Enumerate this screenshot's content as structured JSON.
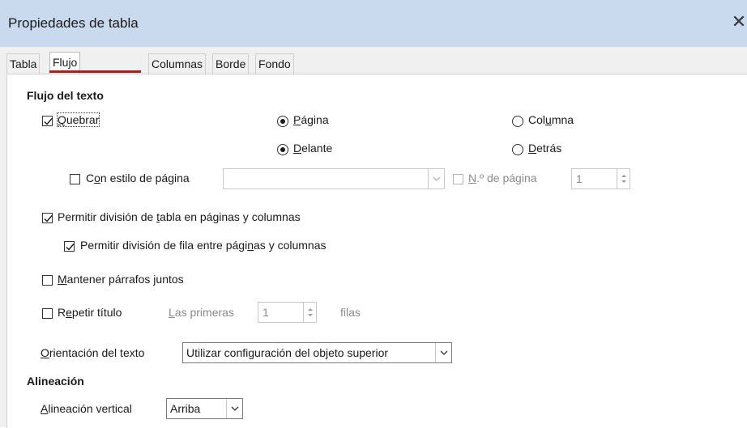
{
  "window": {
    "title": "Propiedades de tabla"
  },
  "tabs": [
    {
      "label": "Tabla"
    },
    {
      "label": "Flujo del texto"
    },
    {
      "label": "Columnas"
    },
    {
      "label": "Borde"
    },
    {
      "label": "Fondo"
    }
  ],
  "colors": {
    "active_tab_indicator": "#e0001b",
    "titlebar": "#c9d9ee"
  },
  "text_flow": {
    "section_title": "Flujo del texto",
    "break": {
      "pre": "",
      "mnemonic": "Q",
      "post": "uebrar",
      "checked": true
    },
    "type": {
      "page": {
        "pre": "",
        "mnemonic": "P",
        "post": "ágina",
        "selected": true
      },
      "column": {
        "pre": "Col",
        "mnemonic": "u",
        "post": "mna",
        "selected": false
      }
    },
    "position": {
      "before": {
        "pre": "",
        "mnemonic": "D",
        "post": "elante",
        "selected": true
      },
      "after": {
        "pre": "",
        "mnemonic": "D",
        "post": "etrás",
        "selected": false
      }
    },
    "with_page_style": {
      "pre": "C",
      "mnemonic": "o",
      "post": "n estilo de página",
      "checked": false,
      "value": ""
    },
    "page_number": {
      "pre": "",
      "mnemonic": "N",
      "post": ".º de página",
      "checked": false,
      "value": "1"
    },
    "allow_table_split": {
      "pre": "Permitir división de ",
      "mnemonic": "t",
      "post": "abla en páginas y columnas",
      "checked": true
    },
    "allow_row_split": {
      "pre": "Permitir división de fila entre pági",
      "mnemonic": "n",
      "post": "as y columnas",
      "checked": true
    },
    "keep_with_next": {
      "pre": "",
      "mnemonic": "M",
      "post": "antener párrafos juntos",
      "checked": false
    },
    "repeat_heading": {
      "pre": "R",
      "mnemonic": "e",
      "post": "petir título",
      "checked": false
    },
    "first_rows": {
      "pre": "",
      "mnemonic": "L",
      "post": "as primeras",
      "value": "1",
      "suffix": "filas"
    },
    "text_orientation": {
      "pre": "",
      "mnemonic": "O",
      "post": "rientación del texto",
      "value": "Utilizar configuración del objeto superior"
    }
  },
  "alignment": {
    "section_title": "Alineación",
    "vertical": {
      "pre": "",
      "mnemonic": "A",
      "post": "lineación vertical",
      "value": "Arriba"
    }
  },
  "icons": [
    "close-icon",
    "check-icon",
    "chevron-down-icon",
    "spin-up-icon",
    "spin-down-icon"
  ]
}
